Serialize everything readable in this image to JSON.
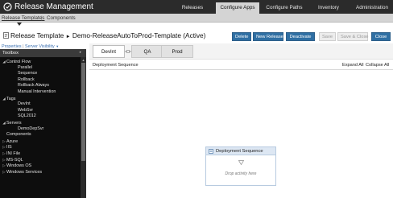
{
  "app": {
    "title": "Release Management"
  },
  "nav": {
    "tabs": [
      {
        "label": "Releases",
        "active": false
      },
      {
        "label": "Configure Apps",
        "active": true
      },
      {
        "label": "Configure Paths",
        "active": false
      },
      {
        "label": "Inventory",
        "active": false
      },
      {
        "label": "Administration",
        "active": false
      }
    ]
  },
  "subnav": {
    "items": [
      "Release Templates",
      "Components"
    ],
    "separator": "|"
  },
  "template": {
    "arrow": "►",
    "breadcrumb_root": "Release Template",
    "name": "Demo-ReleaseAutoToProd-Template (Active)"
  },
  "toolbar": {
    "buttons": [
      {
        "label": "Delete",
        "enabled": true
      },
      {
        "label": "New Release",
        "enabled": true
      },
      {
        "label": "Deactivate",
        "enabled": true
      },
      {
        "label": "Save",
        "enabled": false
      },
      {
        "label": "Save & Close",
        "enabled": false
      },
      {
        "label": "Close",
        "enabled": true
      }
    ]
  },
  "properties_links": {
    "properties": "Properties",
    "separator": "|",
    "server_visibility": "Server Visibility"
  },
  "toolbox": {
    "title": "Toolbox",
    "items": [
      {
        "label": "Control Flow",
        "level": 0,
        "state": "expanded"
      },
      {
        "label": "Parallel",
        "level": 1
      },
      {
        "label": "Sequence",
        "level": 1
      },
      {
        "label": "Rollback",
        "level": 1
      },
      {
        "label": "Rollback Always",
        "level": 1
      },
      {
        "label": "Manual Intervention",
        "level": 1
      },
      {
        "label": "Tags",
        "level": 0,
        "state": "expanded"
      },
      {
        "label": "DevInt",
        "level": 1
      },
      {
        "label": "WebSvr",
        "level": 1
      },
      {
        "label": "SQL2012",
        "level": 1
      },
      {
        "label": "Servers",
        "level": 0,
        "state": "expanded"
      },
      {
        "label": "DemoDepSvr",
        "level": 1
      },
      {
        "label": "Components",
        "level": 0,
        "state": "none"
      },
      {
        "label": "Azure",
        "level": 0,
        "state": "collapsed"
      },
      {
        "label": "IIS",
        "level": 0,
        "state": "collapsed"
      },
      {
        "label": "INI File",
        "level": 0,
        "state": "collapsed"
      },
      {
        "label": "MS-SQL",
        "level": 0,
        "state": "collapsed"
      },
      {
        "label": "Windows OS",
        "level": 0,
        "state": "collapsed"
      },
      {
        "label": "Windows Services",
        "level": 0,
        "state": "collapsed"
      }
    ]
  },
  "stages": [
    {
      "label": "DevInt",
      "active": true
    },
    {
      "label": "QA",
      "active": false
    },
    {
      "label": "Prod",
      "active": false
    }
  ],
  "designer": {
    "sequence_label": "Deployment Sequence",
    "expand_all": "Expand All",
    "collapse_all": "Collapse All",
    "activity_title": "Deployment Sequence",
    "drop_hint": "Drop activity here"
  },
  "colors": {
    "topbar": "#2b2b2b",
    "active_tab": "#d4d4d4",
    "button_primary": "#2f6fa3",
    "toolbox_bg": "#0d0d0d"
  },
  "icons": {
    "logo": "release-management-logo-icon",
    "template": "template-icon",
    "pin": "pin-icon",
    "tree_expanded": "triangle-down-icon",
    "tree_collapsed": "triangle-right-icon",
    "stage_connector": "stage-connector-icon",
    "sequence": "sequence-icon",
    "drop": "drop-arrow-icon"
  }
}
